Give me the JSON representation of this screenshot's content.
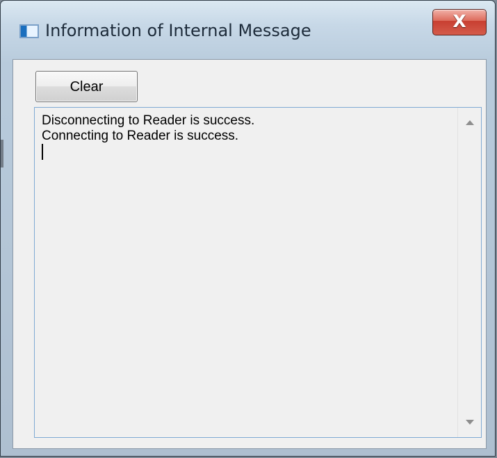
{
  "window": {
    "title": "Information of Internal Message",
    "close_glyph": "X",
    "accent_color": "#d45b4b"
  },
  "toolbar": {
    "clear_label": "Clear"
  },
  "message_log": {
    "lines": [
      "Disconnecting to Reader is success.",
      "Connecting to Reader is success."
    ],
    "caret_visible": true
  },
  "icons": {
    "app": "window-icon",
    "close": "close-icon",
    "scroll_up": "chevron-up-icon",
    "scroll_down": "chevron-down-icon"
  }
}
